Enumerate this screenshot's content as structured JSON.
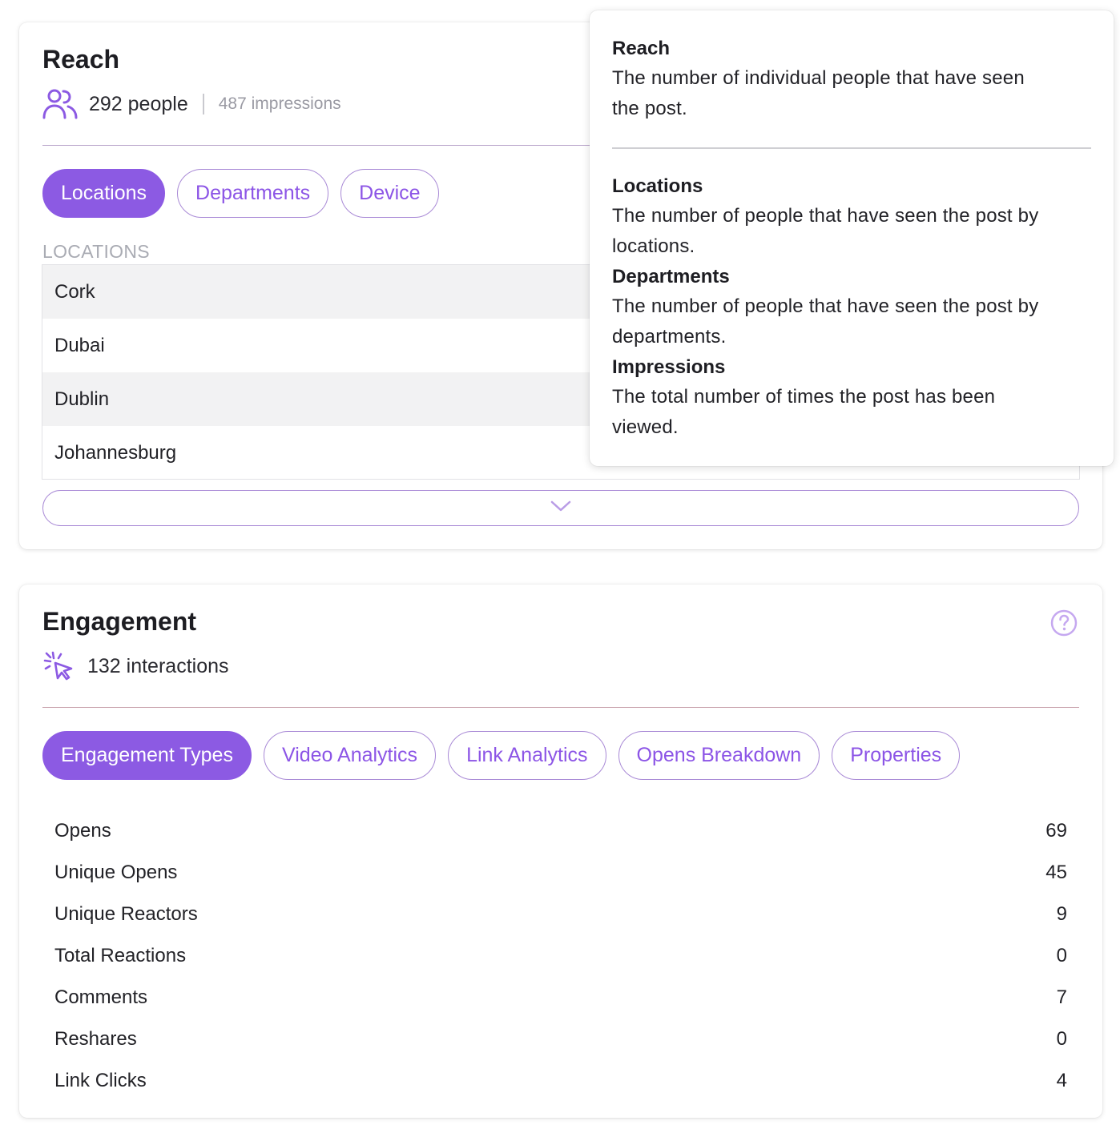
{
  "reach": {
    "title": "Reach",
    "people": "292 people",
    "impressions": "487 impressions",
    "tabs": [
      "Locations",
      "Departments",
      "Device"
    ],
    "section_label": "LOCATIONS",
    "locations": [
      "Cork",
      "Dubai",
      "Dublin",
      "Johannesburg"
    ]
  },
  "tooltip": {
    "reach_head": "Reach",
    "reach_text_1": "The number of individual people that have seen",
    "reach_text_2": "the post.",
    "locations_head": "Locations",
    "locations_text_1": "The number of people that have seen the post by",
    "locations_text_2": "locations.",
    "departments_head": "Departments",
    "departments_text_1": "The number of people that have seen the post by",
    "departments_text_2": "departments.",
    "impressions_head": "Impressions",
    "impressions_text_1": "The total number of times the post has been",
    "impressions_text_2": "viewed."
  },
  "engagement": {
    "title": "Engagement",
    "interactions": "132 interactions",
    "tabs": [
      "Engagement Types",
      "Video Analytics",
      "Link Analytics",
      "Opens Breakdown",
      "Properties"
    ],
    "rows": [
      {
        "label": "Opens",
        "value": "69"
      },
      {
        "label": "Unique Opens",
        "value": "45"
      },
      {
        "label": "Unique Reactors",
        "value": "9"
      },
      {
        "label": "Total Reactions",
        "value": "0"
      },
      {
        "label": "Comments",
        "value": "7"
      },
      {
        "label": "Reshares",
        "value": "0"
      },
      {
        "label": "Link Clicks",
        "value": "4"
      }
    ]
  },
  "colors": {
    "accent": "#8c5ae3",
    "accent_border": "#a98ad6"
  },
  "icons": {
    "people": "people-icon",
    "click": "click-icon",
    "help": "help-circle-icon",
    "chevron": "chevron-down-icon"
  }
}
